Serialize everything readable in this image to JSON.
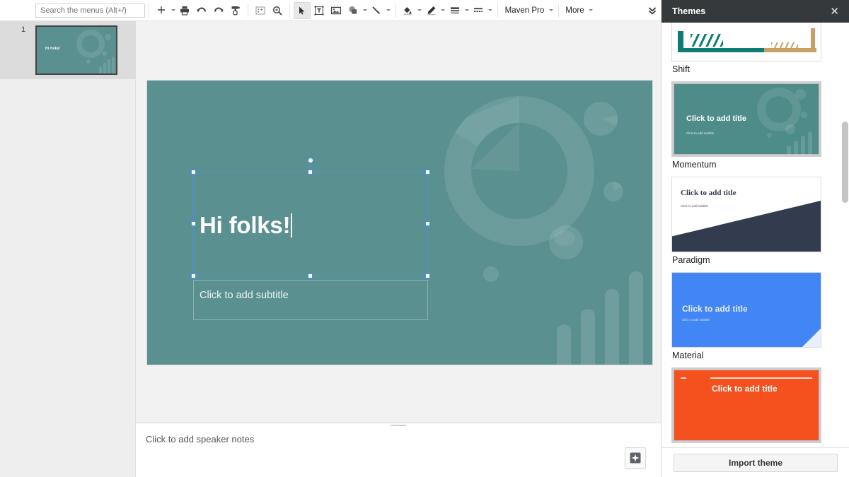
{
  "toolbar": {
    "search_placeholder": "Search the menus (Alt+/)",
    "buttons": [
      {
        "name": "new-slide-button",
        "icon": "plus-icon",
        "label": "+"
      },
      {
        "name": "print-button",
        "icon": "print-icon"
      },
      {
        "name": "undo-button",
        "icon": "undo-icon"
      },
      {
        "name": "redo-button",
        "icon": "redo-icon"
      },
      {
        "name": "paint-format-button",
        "icon": "paint-roller-icon"
      },
      {
        "name": "fit-to-window-button",
        "icon": "fit-screen-icon"
      },
      {
        "name": "zoom-button",
        "icon": "magnifier-icon"
      },
      {
        "name": "select-tool-button",
        "icon": "cursor-arrow-icon"
      },
      {
        "name": "text-box-button",
        "icon": "text-box-icon"
      },
      {
        "name": "insert-image-button",
        "icon": "image-icon"
      },
      {
        "name": "shape-button",
        "icon": "shapes-icon"
      },
      {
        "name": "line-button",
        "icon": "line-icon"
      },
      {
        "name": "fill-color-button",
        "icon": "paint-bucket-icon"
      },
      {
        "name": "border-color-button",
        "icon": "pencil-icon"
      },
      {
        "name": "border-weight-button",
        "icon": "line-weight-icon"
      },
      {
        "name": "border-dash-button",
        "icon": "line-dash-icon"
      }
    ],
    "font_name": "Maven Pro",
    "more_label": "More",
    "collapse_icon": "double-chevron-down-icon"
  },
  "filmstrip": {
    "slides": [
      {
        "number": "1",
        "title": "Hi folks!"
      }
    ]
  },
  "slide": {
    "title": "Hi folks!",
    "subtitle_placeholder": "Click to add subtitle",
    "background_color": "#5b9090",
    "selection_color": "#4a90e2"
  },
  "notes": {
    "placeholder": "Click to add speaker notes",
    "explore_icon": "explore-star-icon"
  },
  "themes_panel": {
    "title": "Themes",
    "close_icon": "close-icon",
    "import_label": "Import theme",
    "themes": [
      {
        "name": "Shift",
        "selected": false,
        "colors": {
          "primary": "#0b7d74",
          "secondary": "#c9a063",
          "bg": "#ffffff"
        }
      },
      {
        "name": "Momentum",
        "selected": true,
        "title_text": "Click to add title",
        "subtitle_text": "Click to add subtitle",
        "colors": {
          "bg": "#4e8c8a",
          "text": "#ffffff"
        }
      },
      {
        "name": "Paradigm",
        "selected": false,
        "title_text": "Click to add title",
        "subtitle_text": "Click to add subtitle",
        "colors": {
          "bg": "#ffffff",
          "accent": "#333b4f",
          "text": "#333b4f"
        }
      },
      {
        "name": "Material",
        "selected": false,
        "title_text": "Click to add title",
        "subtitle_text": "Click to add subtitle",
        "colors": {
          "bg": "#4285f4",
          "text": "#e8f0fe"
        }
      },
      {
        "name": "",
        "selected": false,
        "title_text": "Click to add title",
        "colors": {
          "bg": "#f4511e",
          "text": "#ffffff"
        }
      }
    ]
  }
}
